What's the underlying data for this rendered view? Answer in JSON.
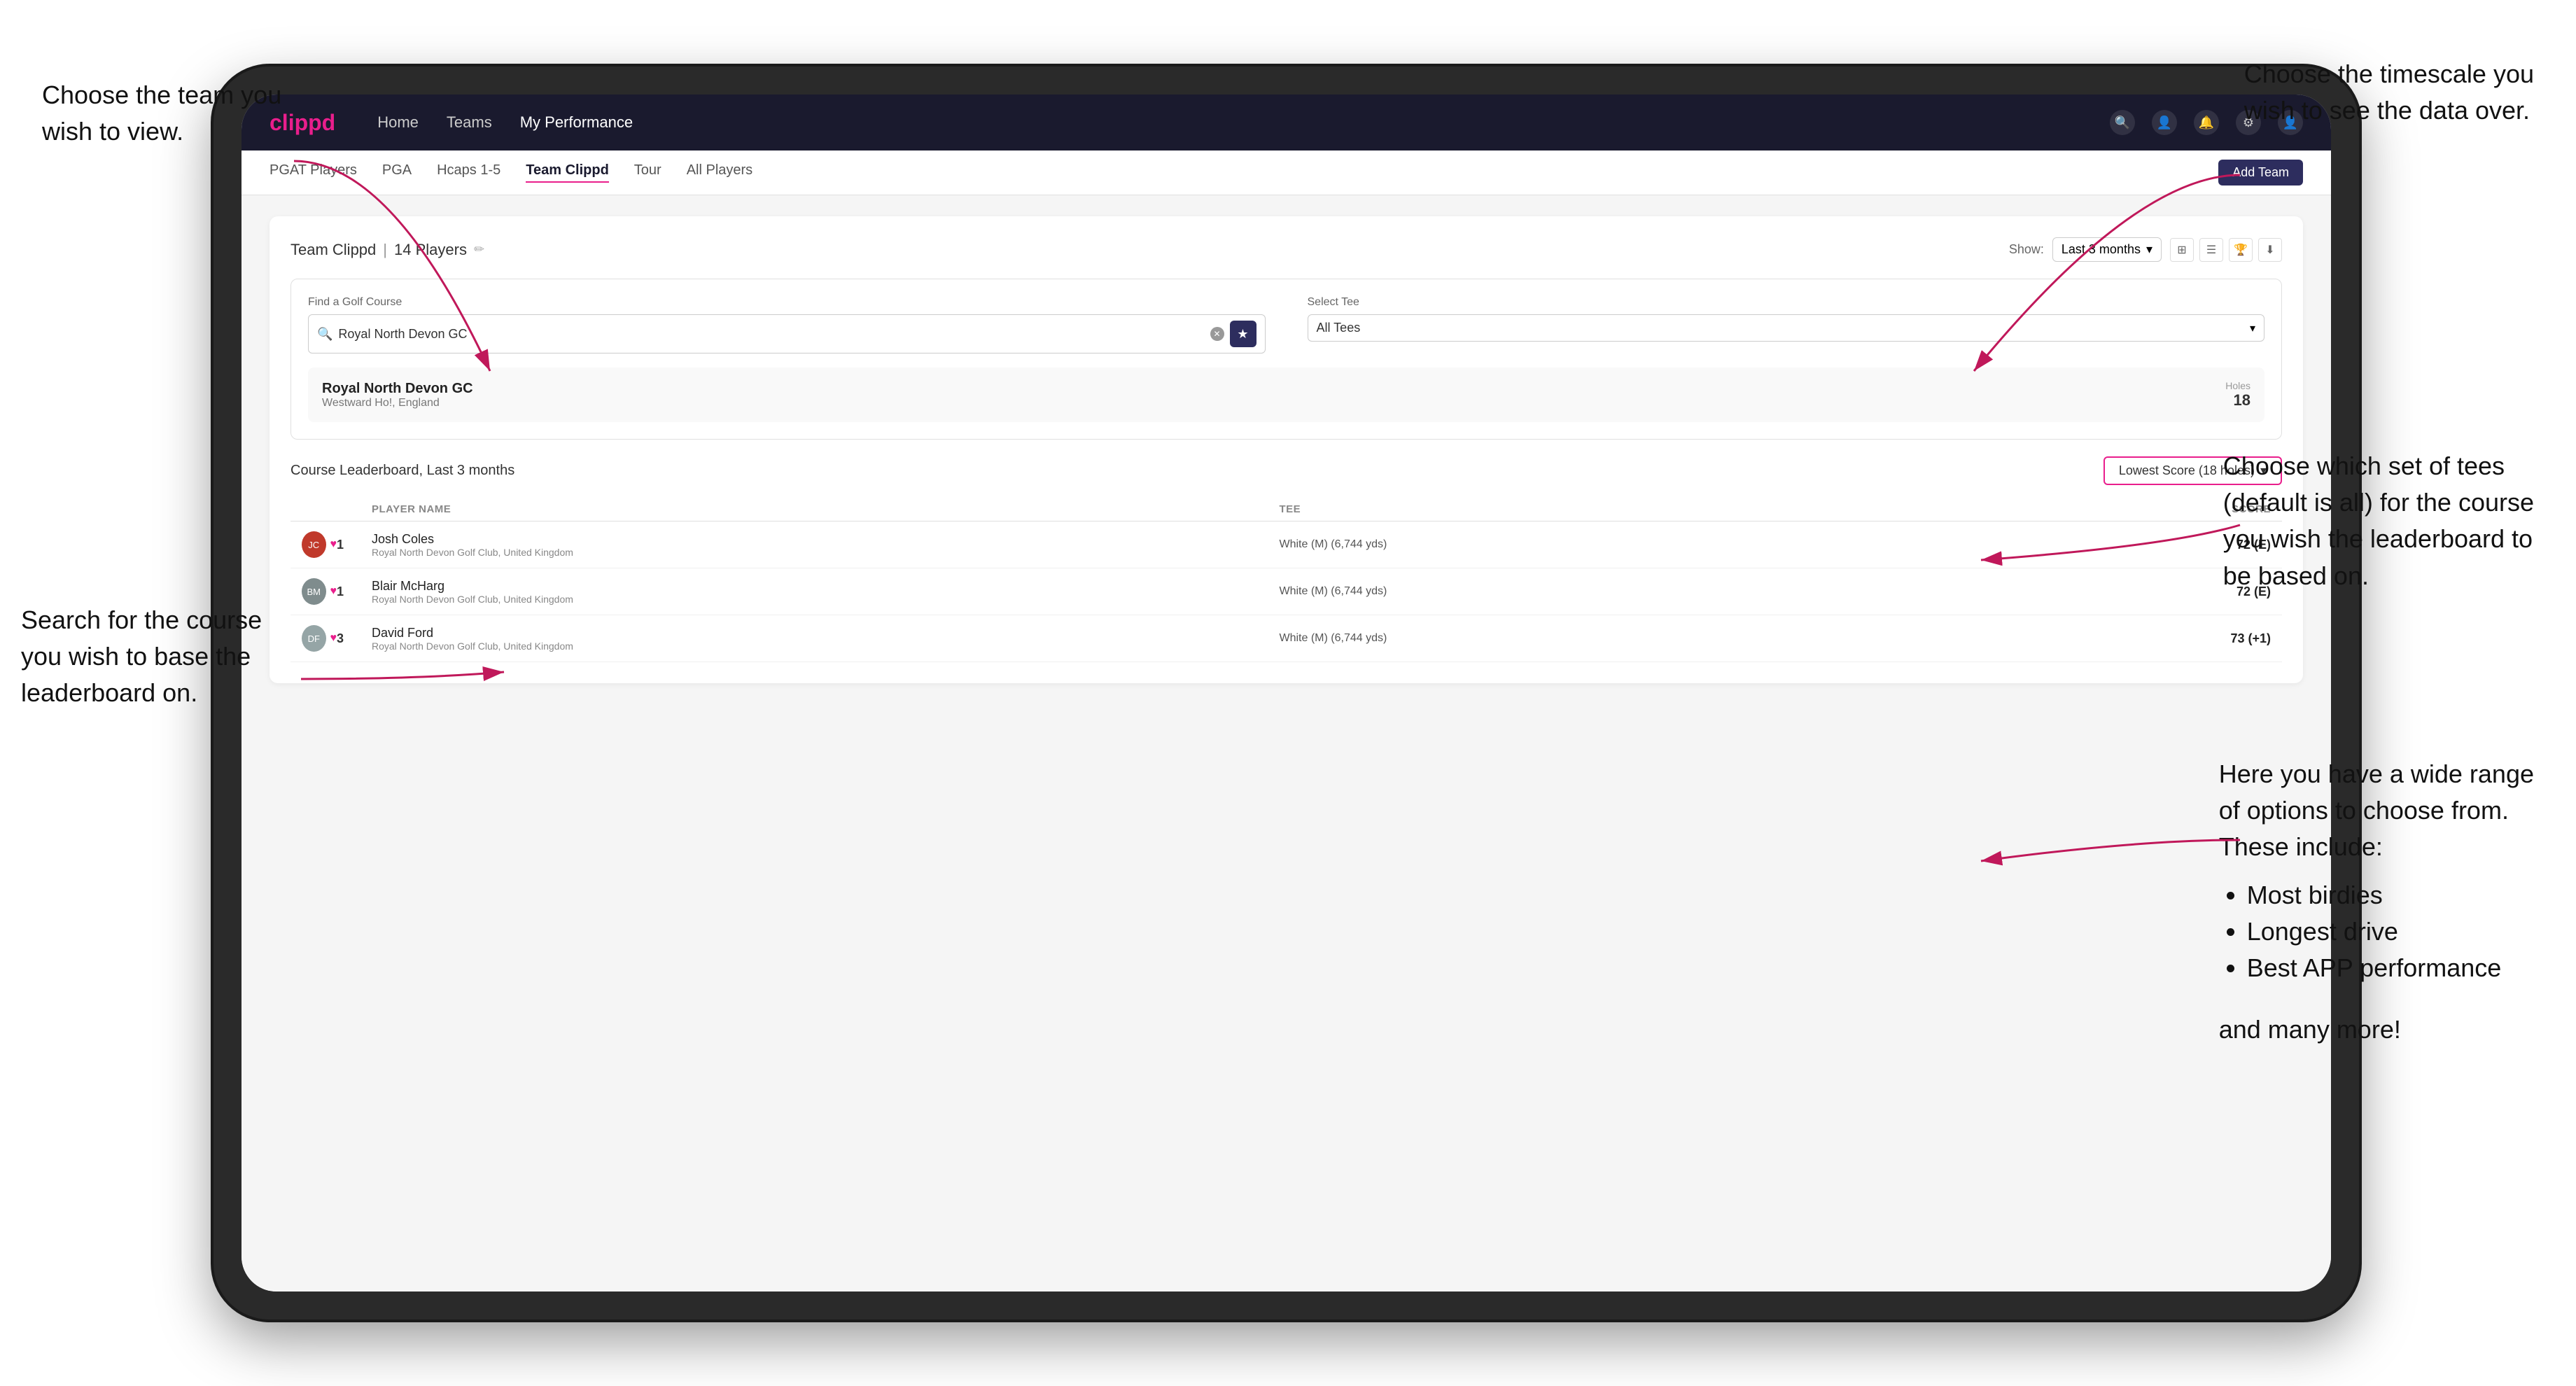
{
  "annotations": {
    "top_left": {
      "line1": "Choose the team you",
      "line2": "wish to view."
    },
    "top_right": {
      "line1": "Choose the timescale you",
      "line2": "wish to see the data over."
    },
    "mid_left": {
      "line1": "Search for the course",
      "line2": "you wish to base the",
      "line3": "leaderboard on."
    },
    "right_options": {
      "intro": "Choose which set of tees",
      "intro2": "(default is all) for the course",
      "intro3": "you wish the leaderboard to",
      "intro4": "be based on."
    },
    "bottom_right_intro": "Here you have a wide range",
    "bottom_right_intro2": "of options to choose from.",
    "bottom_right_intro3": "These include:",
    "bullets": [
      "Most birdies",
      "Longest drive",
      "Best APP performance"
    ],
    "and_more": "and many more!"
  },
  "navbar": {
    "brand": "clippd",
    "links": [
      "Home",
      "Teams",
      "My Performance"
    ],
    "active_link": "My Performance"
  },
  "secondary_nav": {
    "tabs": [
      "PGAT Players",
      "PGA",
      "Hcaps 1-5",
      "Team Clippd",
      "Tour",
      "All Players"
    ],
    "active_tab": "Team Clippd",
    "add_team_label": "Add Team"
  },
  "team_header": {
    "title": "Team Clippd",
    "player_count": "14 Players",
    "show_label": "Show:",
    "show_value": "Last 3 months"
  },
  "course_search": {
    "find_label": "Find a Golf Course",
    "search_value": "Royal North Devon GC",
    "select_tee_label": "Select Tee",
    "tee_value": "All Tees"
  },
  "course_result": {
    "name": "Royal North Devon GC",
    "location": "Westward Ho!, England",
    "holes_label": "Holes",
    "holes_value": "18"
  },
  "leaderboard": {
    "title": "Course Leaderboard, Last 3 months",
    "score_type": "Lowest Score (18 holes)",
    "columns": {
      "player_name": "PLAYER NAME",
      "tee": "TEE",
      "score": "SCORE"
    },
    "players": [
      {
        "rank": "1",
        "name": "Josh Coles",
        "club": "Royal North Devon Golf Club, United Kingdom",
        "tee": "White (M) (6,744 yds)",
        "score": "72 (E)",
        "initials": "JC"
      },
      {
        "rank": "1",
        "name": "Blair McHarg",
        "club": "Royal North Devon Golf Club, United Kingdom",
        "tee": "White (M) (6,744 yds)",
        "score": "72 (E)",
        "initials": "BM"
      },
      {
        "rank": "3",
        "name": "David Ford",
        "club": "Royal North Devon Golf Club, United Kingdom",
        "tee": "White (M) (6,744 yds)",
        "score": "73 (+1)",
        "initials": "DF"
      }
    ]
  }
}
